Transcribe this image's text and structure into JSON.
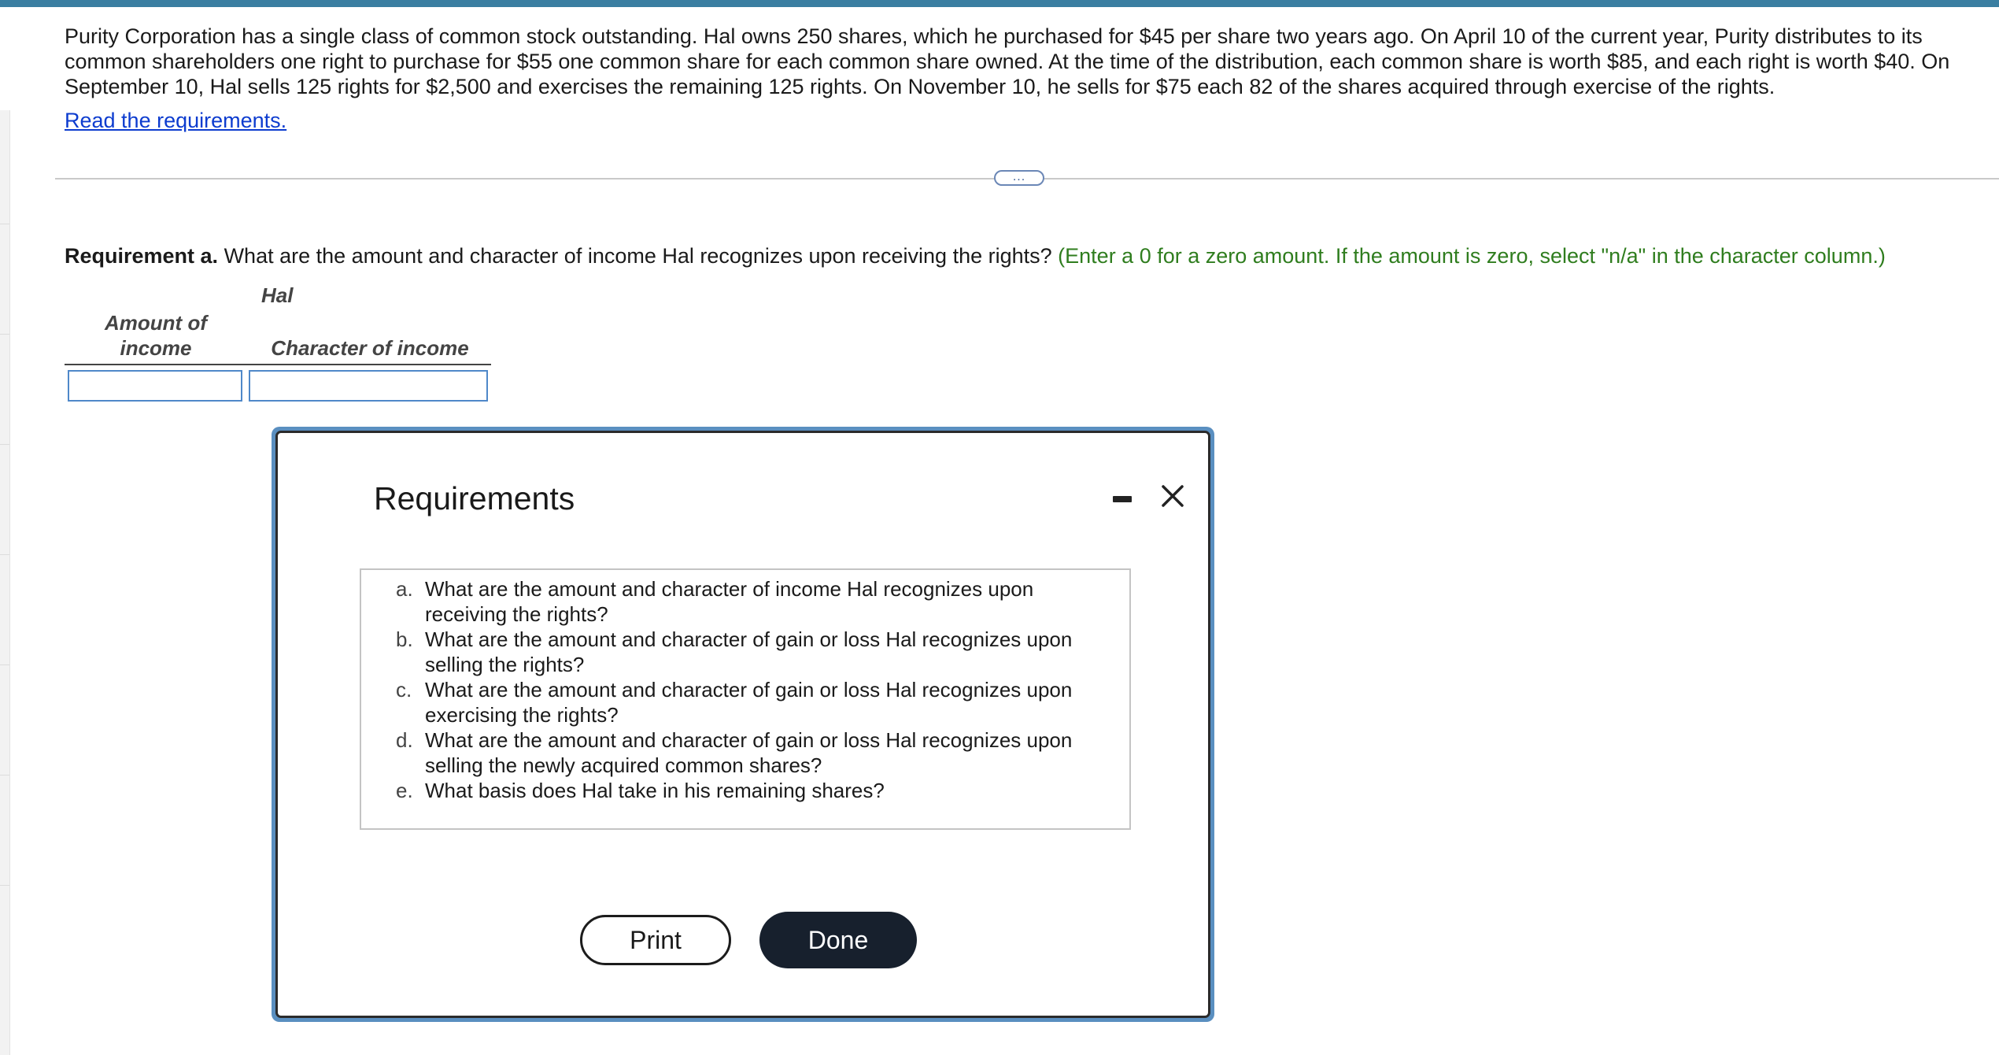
{
  "problem": {
    "text": "Purity Corporation has a single class of common stock outstanding. Hal owns 250 shares, which he purchased for $45 per share two years ago. On April 10 of the current year, Purity distributes to its common shareholders one right to purchase for $55 one common share for each common share owned. At the time of the distribution, each common share is worth $85, and each right is worth $40. On September 10, Hal sells 125 rights for $2,500 and exercises the remaining 125 rights. On November 10, he sells for $75 each 82 of the shares acquired through exercise of the rights.",
    "read_link": "Read the requirements."
  },
  "expand_button": "...",
  "requirement_a": {
    "label": "Requirement a.",
    "question": " What are the amount and character of income Hal recognizes upon receiving the rights?",
    "hint": " (Enter a 0 for a zero amount. If the amount is zero, select \"n/a\" in the character column.)"
  },
  "answer_table": {
    "group_heading": "Hal",
    "col_amount_line1": "Amount of",
    "col_amount_line2": "income",
    "col_character": "Character of income",
    "amount_value": "",
    "character_value": ""
  },
  "modal": {
    "title": "Requirements",
    "items": [
      {
        "letter": "a.",
        "text": "What are the amount and character of income Hal recognizes upon receiving the rights?"
      },
      {
        "letter": "b.",
        "text": "What are the amount and character of gain or loss Hal recognizes upon selling the rights?"
      },
      {
        "letter": "c.",
        "text": "What are the amount and character of gain or loss Hal recognizes upon exercising the rights?"
      },
      {
        "letter": "d.",
        "text": "What are the amount and character of gain or loss Hal recognizes upon selling the newly acquired common shares?"
      },
      {
        "letter": "e.",
        "text": "What basis does Hal take in his remaining shares?"
      }
    ],
    "print_label": "Print",
    "done_label": "Done",
    "minimize_icon": "minimize-icon",
    "close_icon": "close-icon"
  },
  "colors": {
    "top_bar": "#3a7ea1",
    "link": "#0d3ccf",
    "hint_green": "#2f7d1e",
    "input_border": "#4f88c9",
    "modal_frame": "#5a8fc0",
    "done_button": "#17202d"
  }
}
